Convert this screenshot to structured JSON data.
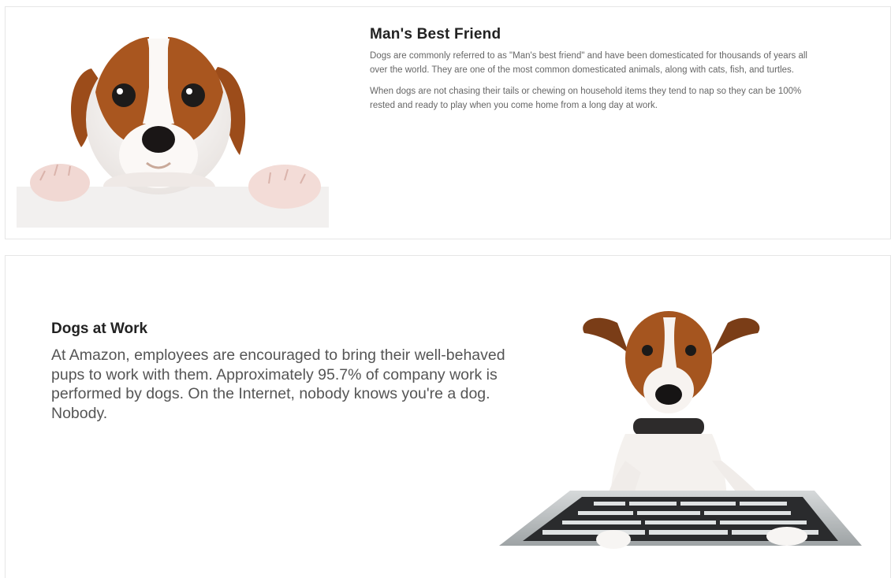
{
  "section1": {
    "title": "Man's Best Friend",
    "paragraphs": [
      "Dogs are commonly referred to as \"Man's best friend\" and have been domesticated for thousands of years all over the world. They are one of the most common domesticated animals, along with cats, fish, and turtles.",
      "When dogs are not chasing their tails or chewing on household items they tend to nap so they can be 100% rested and ready to play when you come home from a long day at work."
    ],
    "image": "puppy-peeking-over-ledge"
  },
  "section2": {
    "title": "Dogs at Work",
    "paragraph": "At Amazon, employees are encouraged to bring their well-behaved pups to work with them. Approximately 95.7% of company work is performed by dogs. On the Internet, nobody knows you're a dog. Nobody.",
    "image": "dog-typing-on-keyboard"
  },
  "colors": {
    "dog_brown": "#a5551f",
    "keyboard_gray": "#b9bdbf"
  }
}
